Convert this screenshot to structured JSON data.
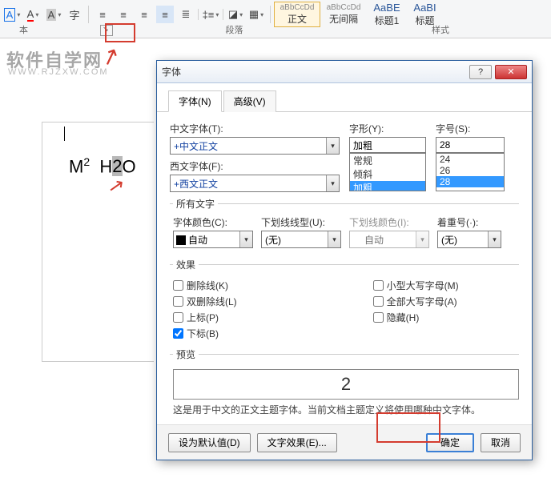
{
  "ribbon": {
    "group1": "本",
    "group2": "段落",
    "group3": "样式",
    "styles": [
      {
        "small": "aBbCcDd",
        "big": "正文"
      },
      {
        "small": "aBbCcDd",
        "big": "无间隔"
      },
      {
        "small": "AaBE",
        "big": "标题1"
      },
      {
        "small": "AaBI",
        "big": "标题"
      }
    ]
  },
  "watermark": {
    "l1": "软件自学网",
    "l2": "WWW.RJZXW.COM"
  },
  "doc": {
    "expr1": "M",
    "sup": "2",
    "space": " ",
    "expr2": "H",
    "selchar": "2",
    "expr3": "O"
  },
  "dialog": {
    "title": "字体",
    "tabs": {
      "font": "字体(N)",
      "adv": "高级(V)"
    },
    "labels": {
      "cjk": "中文字体(T):",
      "latin": "西文字体(F):",
      "style": "字形(Y):",
      "size": "字号(S):",
      "allText": "所有文字",
      "color": "字体颜色(C):",
      "uline": "下划线线型(U):",
      "ucolor": "下划线颜色(I):",
      "emph": "着重号(·):",
      "effects": "效果",
      "preview": "预览"
    },
    "values": {
      "cjk": "+中文正文",
      "latin": "+西文正文",
      "style": "加粗",
      "size": "28",
      "color": "自动",
      "uline": "(无)",
      "ucolor": "自动",
      "emph": "(无)"
    },
    "styleList": [
      "常规",
      "倾斜",
      "加粗"
    ],
    "sizeList": [
      "24",
      "26",
      "28"
    ],
    "effectChk": {
      "strike": "删除线(K)",
      "dstrike": "双删除线(L)",
      "super": "上标(P)",
      "sub": "下标(B)",
      "smallcaps": "小型大写字母(M)",
      "allcaps": "全部大写字母(A)",
      "hidden": "隐藏(H)"
    },
    "previewText": "2",
    "previewNote": "这是用于中文的正文主题字体。当前文档主题定义将使用哪种中文字体。",
    "buttons": {
      "setDefault": "设为默认值(D)",
      "textFx": "文字效果(E)...",
      "ok": "确定",
      "cancel": "取消"
    }
  }
}
